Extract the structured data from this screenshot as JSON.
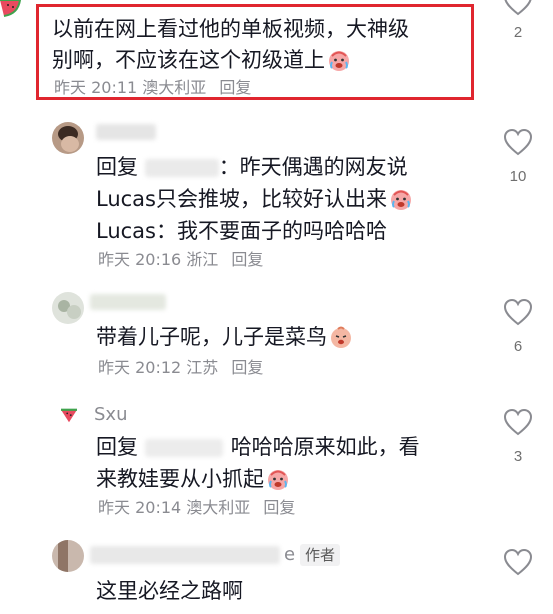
{
  "comments": [
    {
      "text_line1": "以前在网上看过他的单板视频，大神级",
      "text_line2": "别啊，不应该在这个初级道上",
      "time": "昨天 20:11",
      "location": "澳大利亚",
      "reply_label": "回复",
      "likes": "2"
    },
    {
      "reply_prefix": "回复",
      "text_line1_suffix": "：昨天偶遇的网友说",
      "text_line2": "Lucas只会推坡，比较好认出来",
      "text_line3": "Lucas：我不要面子的吗哈哈哈",
      "time": "昨天 20:16",
      "location": "浙江",
      "reply_label": "回复",
      "likes": "10"
    },
    {
      "text_line1": "带着儿子呢，儿子是菜鸟",
      "time": "昨天 20:12",
      "location": "江苏",
      "reply_label": "回复",
      "likes": "6"
    },
    {
      "username": "Sxu",
      "reply_prefix": "回复",
      "text_line1_suffix": "哈哈哈原来如此，看",
      "text_line2": "来教娃要从小抓起",
      "time": "昨天 20:14",
      "location": "澳大利亚",
      "reply_label": "回复",
      "likes": "3"
    },
    {
      "username_tail": "e",
      "author_tag": "作者",
      "text_line1": "这里必经之路啊"
    }
  ],
  "colors": {
    "highlight_border": "#e0262f",
    "meta_text": "#8a8b91",
    "body_text": "#161823"
  }
}
